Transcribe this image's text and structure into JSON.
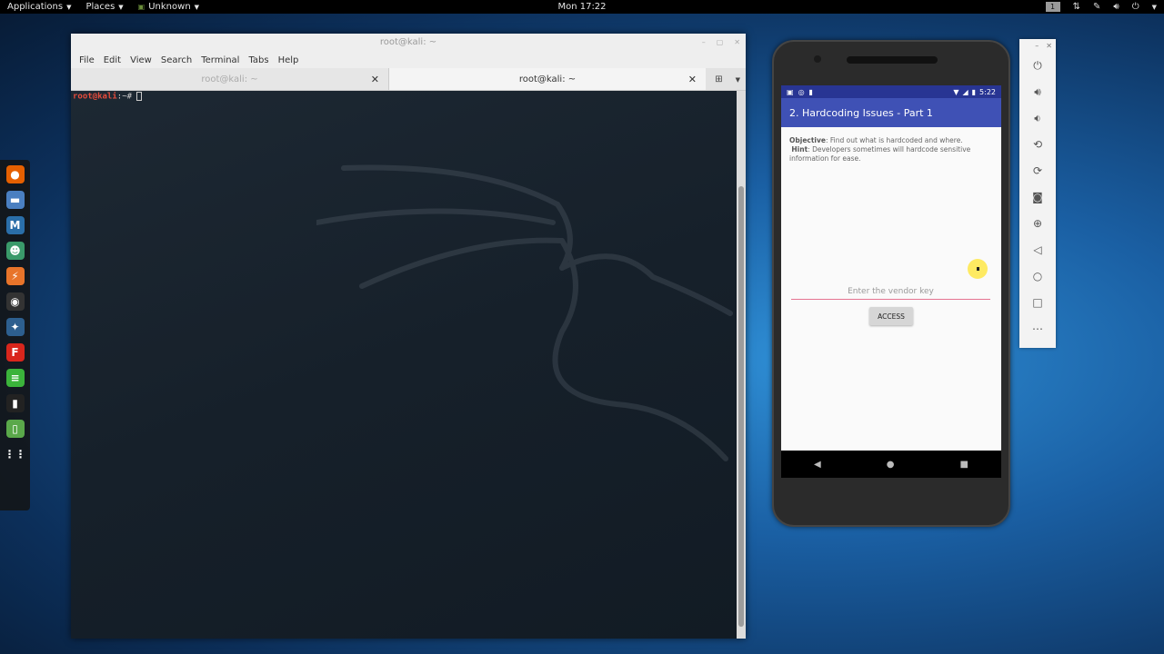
{
  "topbar": {
    "applications": "Applications",
    "places": "Places",
    "unknown": "Unknown",
    "clock": "Mon 17:22",
    "workspace": "1"
  },
  "dock": {
    "apps": [
      {
        "name": "firefox-icon",
        "glyph": "●",
        "color": "#e66000"
      },
      {
        "name": "files-icon",
        "glyph": "▬",
        "color": "#4a7fc1"
      },
      {
        "name": "metasploit-icon",
        "glyph": "M",
        "color": "#2a6ea8"
      },
      {
        "name": "armitage-icon",
        "glyph": "☻",
        "color": "#3a9a6a"
      },
      {
        "name": "burpsuite-icon",
        "glyph": "⚡",
        "color": "#e8742a"
      },
      {
        "name": "beef-icon",
        "glyph": "◉",
        "color": "#333"
      },
      {
        "name": "faraday-icon",
        "glyph": "✦",
        "color": "#2d5f8f"
      },
      {
        "name": "fern-icon",
        "glyph": "F",
        "color": "#d9261c"
      },
      {
        "name": "leafpad-icon",
        "glyph": "≡",
        "color": "#3bb33b"
      },
      {
        "name": "terminal-icon",
        "glyph": "▮",
        "color": "#222"
      },
      {
        "name": "notes-icon",
        "glyph": "▯",
        "color": "#5aa84a"
      },
      {
        "name": "apps-grid-icon",
        "glyph": "⋮⋮",
        "color": "transparent"
      }
    ]
  },
  "terminal": {
    "title": "root@kali: ~",
    "menu": [
      "File",
      "Edit",
      "View",
      "Search",
      "Terminal",
      "Tabs",
      "Help"
    ],
    "tabs": [
      {
        "label": "root@kali: ~"
      },
      {
        "label": "root@kali: ~"
      }
    ],
    "prompt_user": "root@kali",
    "prompt_sep": ":~#"
  },
  "phone": {
    "time": "5:22",
    "app_title": "2. Hardcoding Issues - Part 1",
    "objective_label": "Objective",
    "objective_text": ": Find out what is hardcoded and where.",
    "hint_label": "Hint",
    "hint_text": ": Developers sometimes will hardcode sensitive information for ease.",
    "input_placeholder": "Enter the vendor key",
    "button_label": "ACCESS"
  }
}
